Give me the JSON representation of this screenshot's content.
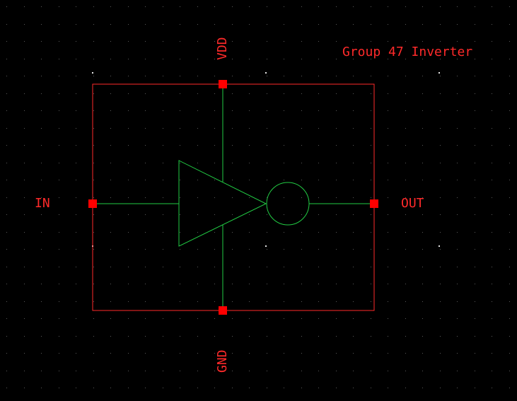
{
  "diagram": {
    "title": "Group 47 Inverter",
    "pins": {
      "top": "VDD",
      "bottom": "GND",
      "left": "IN",
      "right": "OUT"
    }
  },
  "colors": {
    "background": "#000000",
    "grid_dot": "#5a5a5a",
    "grid_dot_major": "#e6e6e6",
    "symbol_box": "#ff2a2a",
    "pin_marker": "#ff0000",
    "wire": "#22cc44",
    "label": "#ff2a2a"
  },
  "icons": {
    "inverter_symbol": "triangle-with-bubble",
    "pin_marker": "filled-square"
  }
}
